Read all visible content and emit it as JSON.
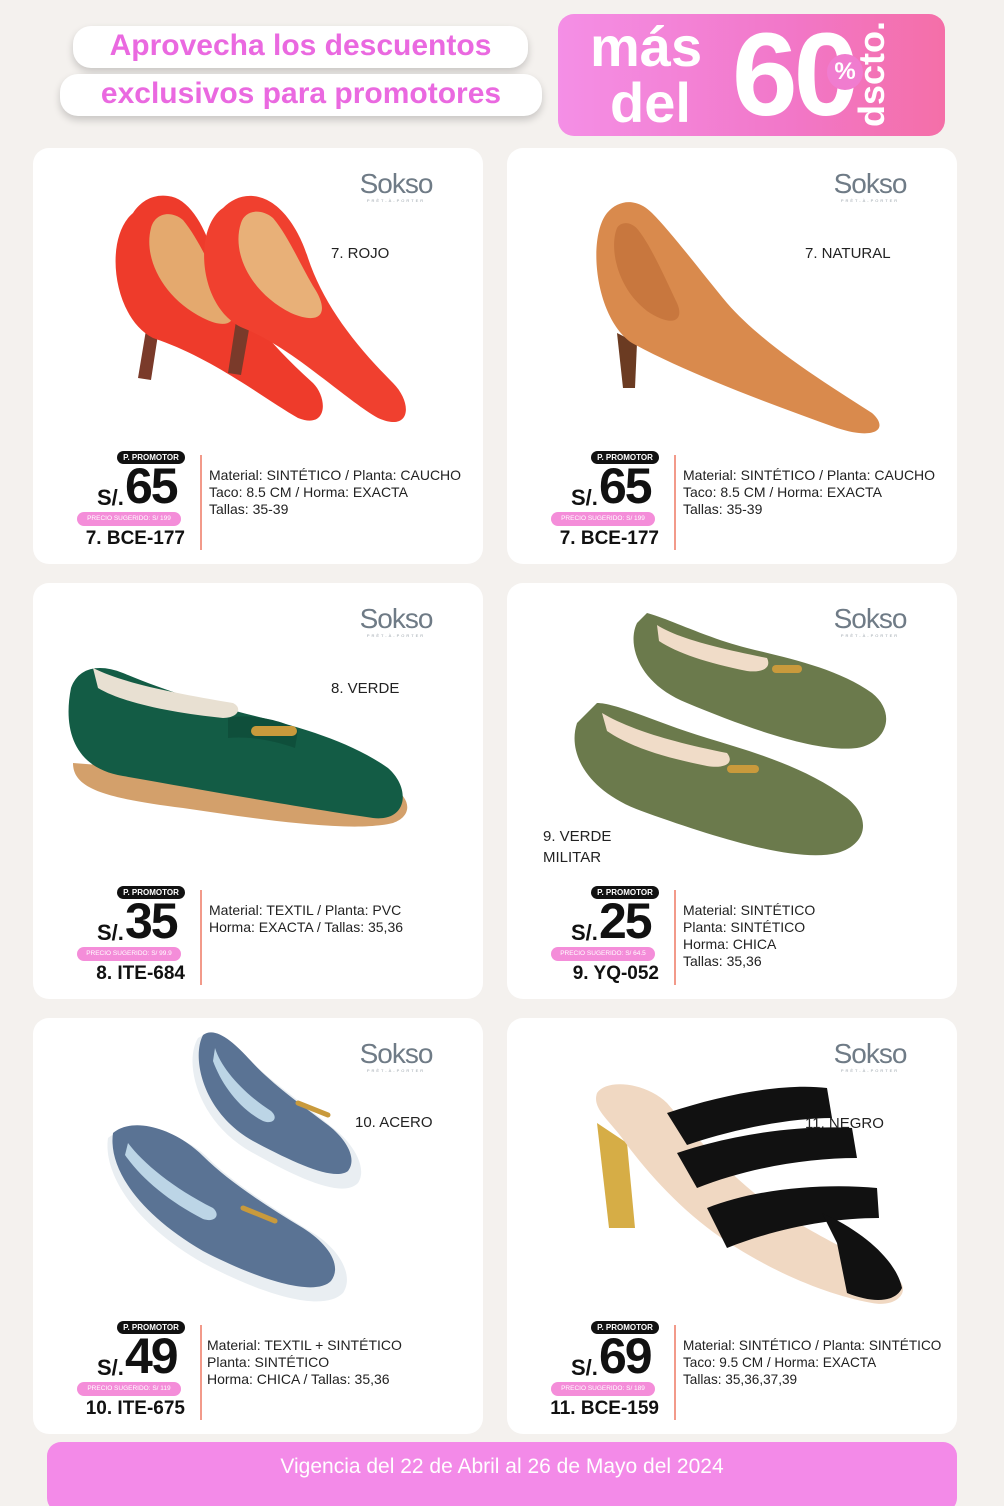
{
  "header": {
    "line1": "Aprovecha los descuentos",
    "line2": "exclusivos para promotores",
    "badge": {
      "word1": "más",
      "word2": "del",
      "number": "60",
      "percent": "%",
      "word3": "dscto."
    }
  },
  "labels": {
    "promotor": "P. PROMOTOR",
    "currency": "S/."
  },
  "brand": {
    "name": "Sokso",
    "tagline": "PRÊT-À-PORTER"
  },
  "products": [
    {
      "color": "7. ROJO",
      "price": "65",
      "suggested": "PRECIO SUGERIDO: S/ 199",
      "code": "7. BCE-177",
      "specs": [
        "Material: SINTÉTICO / Planta: CAUCHO",
        "Taco: 8.5 CM / Horma: EXACTA",
        "Tallas: 35-39"
      ],
      "shoe_icon": "red-pumps-image",
      "shoe_color": "#ee3b2b"
    },
    {
      "color": "7. NATURAL",
      "price": "65",
      "suggested": "PRECIO SUGERIDO: S/ 199",
      "code": "7. BCE-177",
      "specs": [
        "Material: SINTÉTICO / Planta: CAUCHO",
        "Taco: 8.5 CM / Horma: EXACTA",
        "Tallas: 35-39"
      ],
      "shoe_icon": "tan-pump-image",
      "shoe_color": "#d98a4d"
    },
    {
      "color": "8. VERDE",
      "price": "35",
      "suggested": "PRECIO SUGERIDO: S/ 99.9",
      "code": "8. ITE-684",
      "specs": [
        "Material: TEXTIL / Planta: PVC",
        "Horma: EXACTA / Tallas: 35,36"
      ],
      "shoe_icon": "green-velvet-loafer-image",
      "shoe_color": "#135c45"
    },
    {
      "color": "9. VERDE\nMILITAR",
      "color_line1": "9. VERDE",
      "color_line2": "MILITAR",
      "price": "25",
      "suggested": "PRECIO SUGERIDO: S/ 64.5",
      "code": "9. YQ-052",
      "specs": [
        "Material: SINTÉTICO",
        "Planta: SINTÉTICO",
        "Horma: CHICA",
        "Tallas: 35,36"
      ],
      "shoe_icon": "olive-loafers-image",
      "shoe_color": "#6b7a4c"
    },
    {
      "color": "10. ACERO",
      "price": "49",
      "suggested": "PRECIO SUGERIDO: S/ 119",
      "code": "10. ITE-675",
      "specs": [
        "Material: TEXTIL + SINTÉTICO",
        "Planta: SINTÉTICO",
        "Horma: CHICA / Tallas: 35,36"
      ],
      "shoe_icon": "blue-loafers-image",
      "shoe_color": "#5a7394"
    },
    {
      "color": "11. NEGRO",
      "price": "69",
      "suggested": "PRECIO SUGERIDO: S/ 189",
      "code": "11. BCE-159",
      "specs": [
        "Material: SINTÉTICO / Planta: SINTÉTICO",
        "Taco: 9.5 CM / Horma: EXACTA",
        "Tallas: 35,36,37,39"
      ],
      "shoe_icon": "black-strap-sandal-image",
      "shoe_color": "#111111"
    }
  ],
  "footer": {
    "text": "Vigencia del 22 de Abril al 26 de Mayo del 2024"
  },
  "colors": {
    "accent_pink": "#f38ae8",
    "background": "#f4f1ee"
  }
}
